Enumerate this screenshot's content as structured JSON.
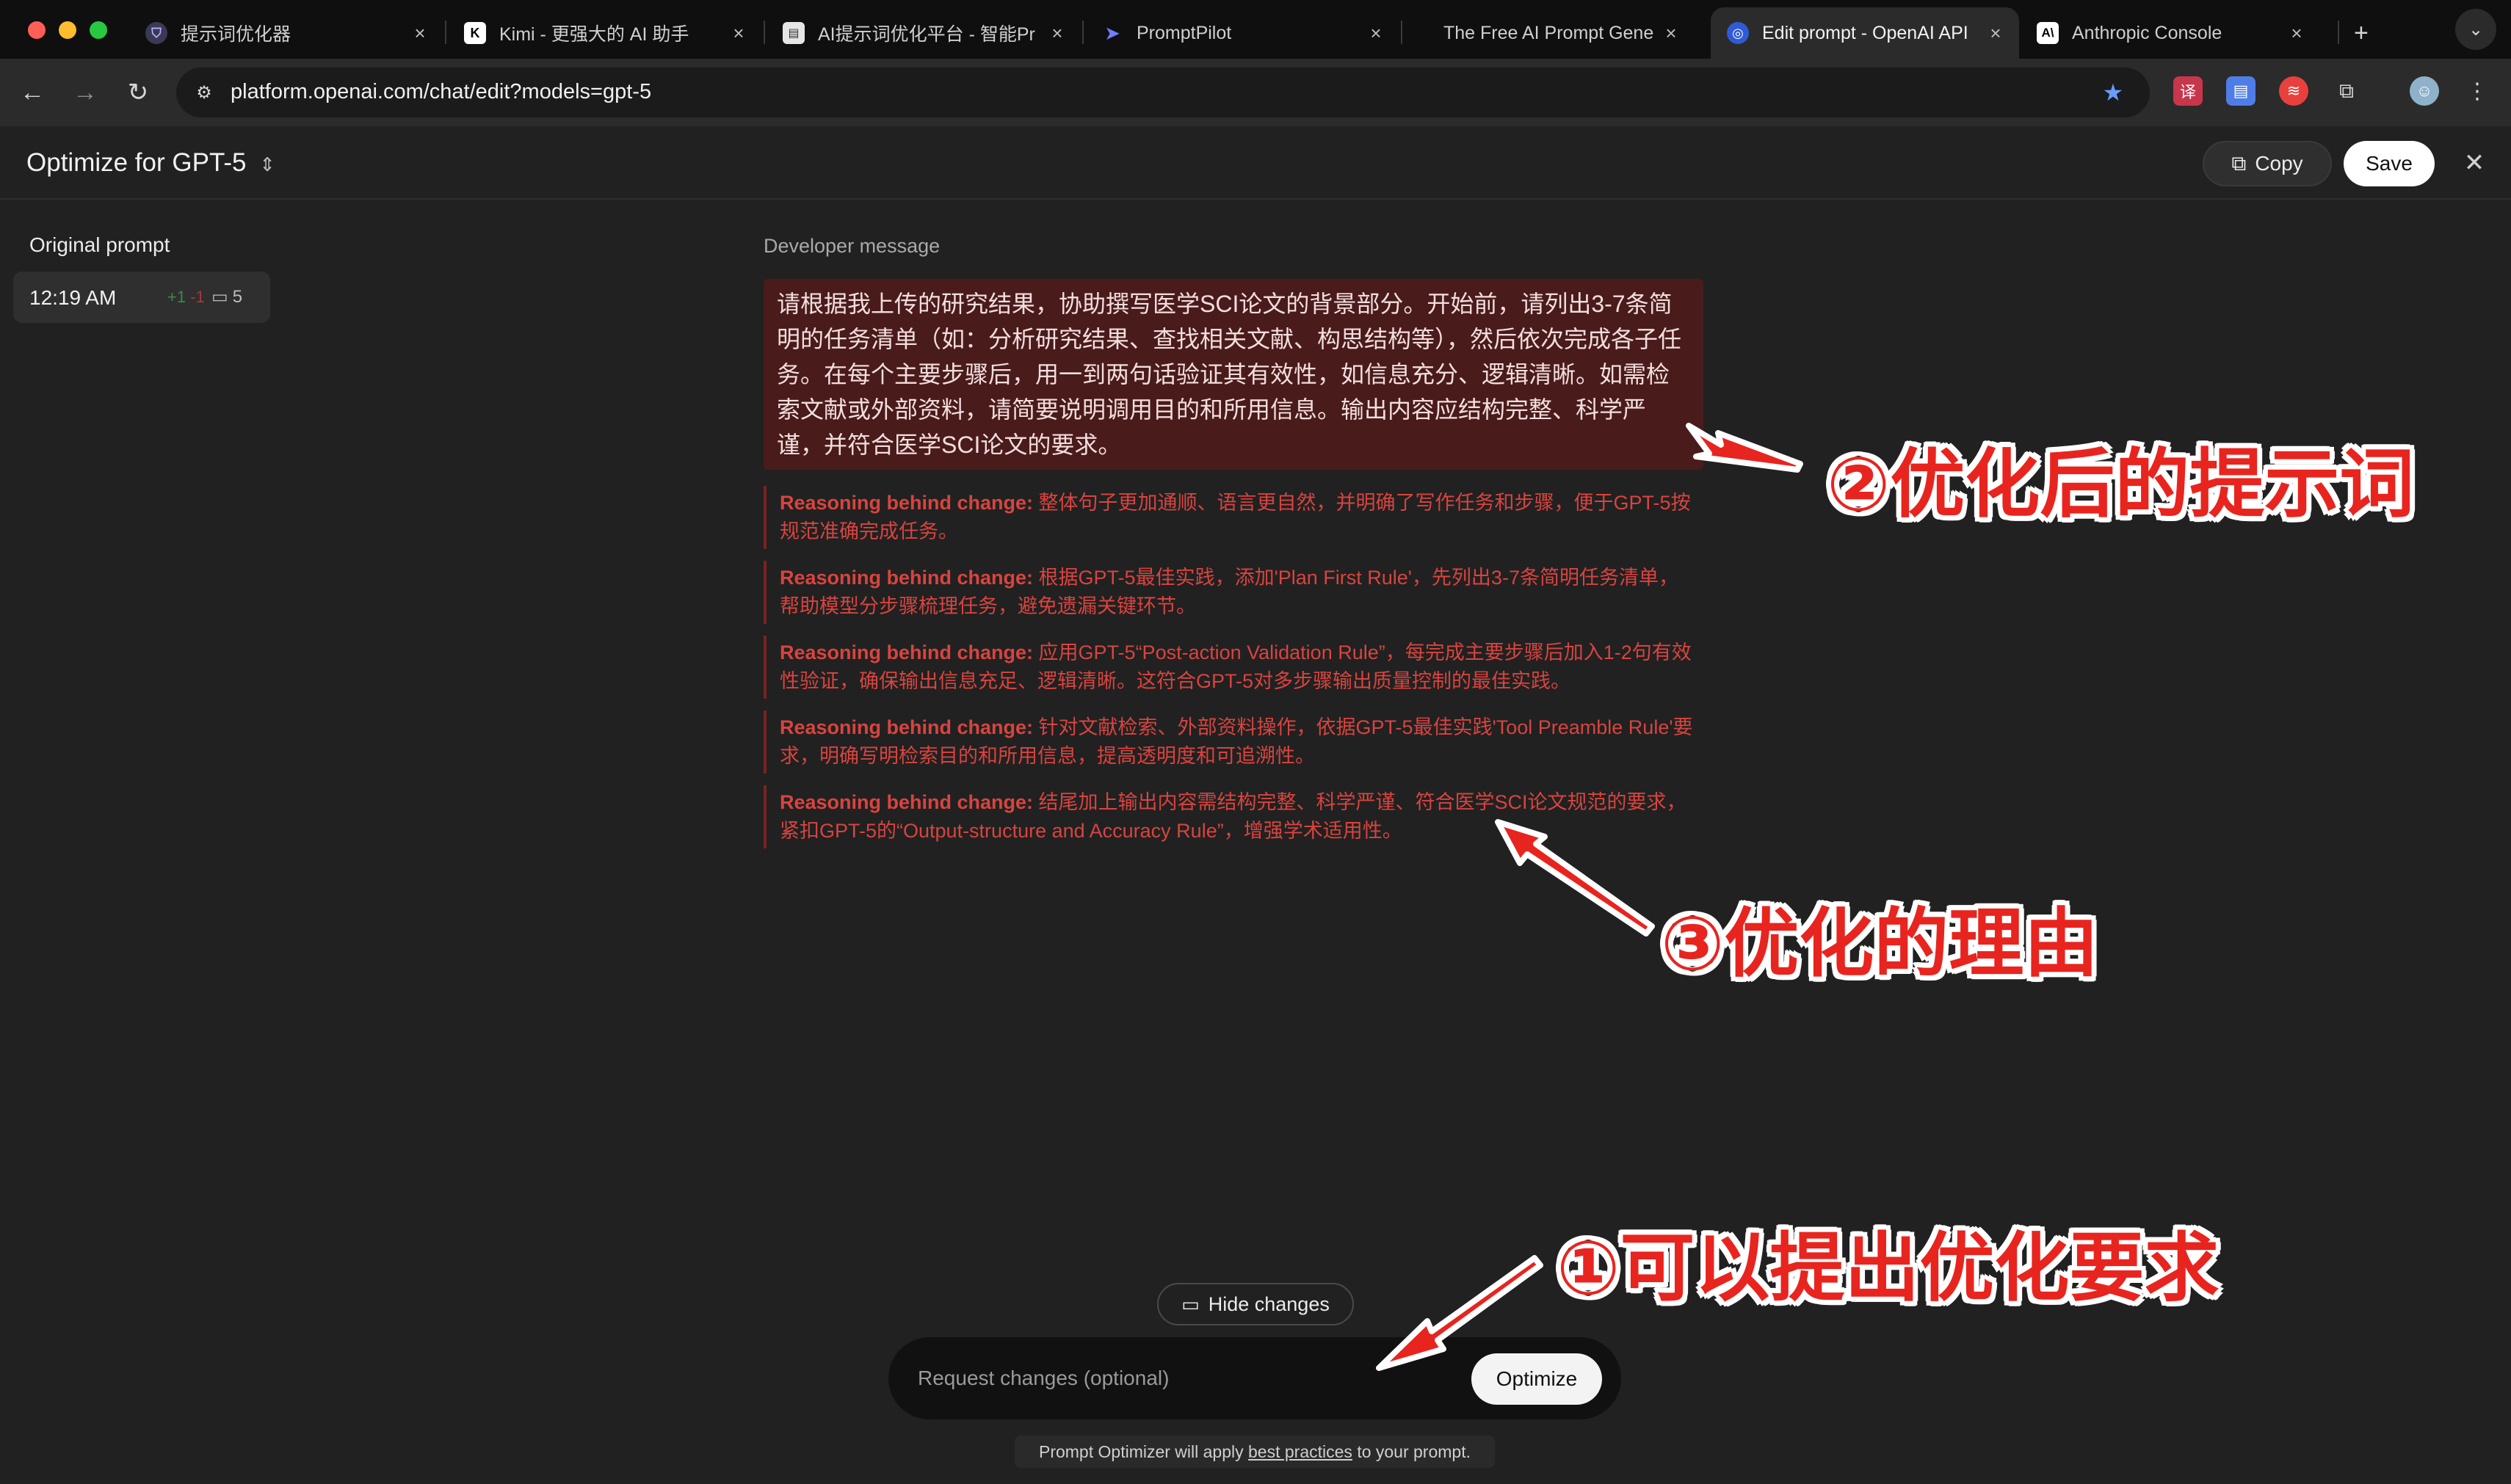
{
  "browser": {
    "tabs": [
      {
        "title": "提示词优化器",
        "favicon": "shield-icon",
        "active": false
      },
      {
        "title": "Kimi - 更强大的 AI 助手",
        "favicon": "kimi-k-icon",
        "active": false
      },
      {
        "title": "AI提示词优化平台 - 智能Pr",
        "favicon": "document-icon",
        "active": false
      },
      {
        "title": "PromptPilot",
        "favicon": "paper-plane-icon",
        "active": false
      },
      {
        "title": "The Free AI Prompt Gene",
        "favicon": "blank-icon",
        "active": false
      },
      {
        "title": "Edit prompt - OpenAI API",
        "favicon": "openai-icon",
        "active": true
      },
      {
        "title": "Anthropic Console",
        "favicon": "anthropic-icon",
        "active": false
      }
    ],
    "new_tab": "+",
    "url": "platform.openai.com/chat/edit?models=gpt-5"
  },
  "header": {
    "title": "Optimize for GPT-5",
    "copy_label": "Copy",
    "save_label": "Save"
  },
  "sidebar": {
    "label": "Original prompt",
    "version": {
      "time": "12:19 AM",
      "added": "+1",
      "removed": "-1",
      "comments": "5"
    }
  },
  "main": {
    "label": "Developer message",
    "prompt": "请根据我上传的研究结果，协助撰写医学SCI论文的背景部分。开始前，请列出3-7条简明的任务清单（如：分析研究结果、查找相关文献、构思结构等），然后依次完成各子任务。在每个主要步骤后，用一到两句话验证其有效性，如信息充分、逻辑清晰。如需检索文献或外部资料，请简要说明调用目的和所用信息。输出内容应结构完整、科学严谨，并符合医学SCI论文的要求。",
    "reason_prefix": "Reasoning behind change:",
    "reasons": [
      "整体句子更加通顺、语言更自然，并明确了写作任务和步骤，便于GPT-5按规范准确完成任务。",
      "根据GPT-5最佳实践，添加'Plan First Rule'，先列出3-7条简明任务清单，帮助模型分步骤梳理任务，避免遗漏关键环节。",
      "应用GPT-5“Post-action Validation Rule”，每完成主要步骤后加入1-2句有效性验证，确保输出信息充足、逻辑清晰。这符合GPT-5对多步骤输出质量控制的最佳实践。",
      "针对文献检索、外部资料操作，依据GPT-5最佳实践'Tool Preamble Rule'要求，明确写明检索目的和所用信息，提高透明度和可追溯性。",
      "结尾加上输出内容需结构完整、科学严谨、符合医学SCI论文规范的要求，紧扣GPT-5的“Output-structure and Accuracy Rule”，增强学术适用性。"
    ]
  },
  "bottom": {
    "hide_changes": "Hide changes",
    "request_placeholder": "Request changes (optional)",
    "optimize_label": "Optimize",
    "footnote_pre": "Prompt Optimizer will apply",
    "footnote_link": "best practices",
    "footnote_post": "to your prompt."
  },
  "annotations": {
    "a1": "①可以提出优化要求",
    "a2": "②优化后的提示词",
    "a3": "③优化的理由"
  },
  "colors": {
    "background": "#212121",
    "prompt_highlight": "#4a1b1b",
    "reason_text": "#d8443f",
    "annotation": "#e8241f"
  }
}
